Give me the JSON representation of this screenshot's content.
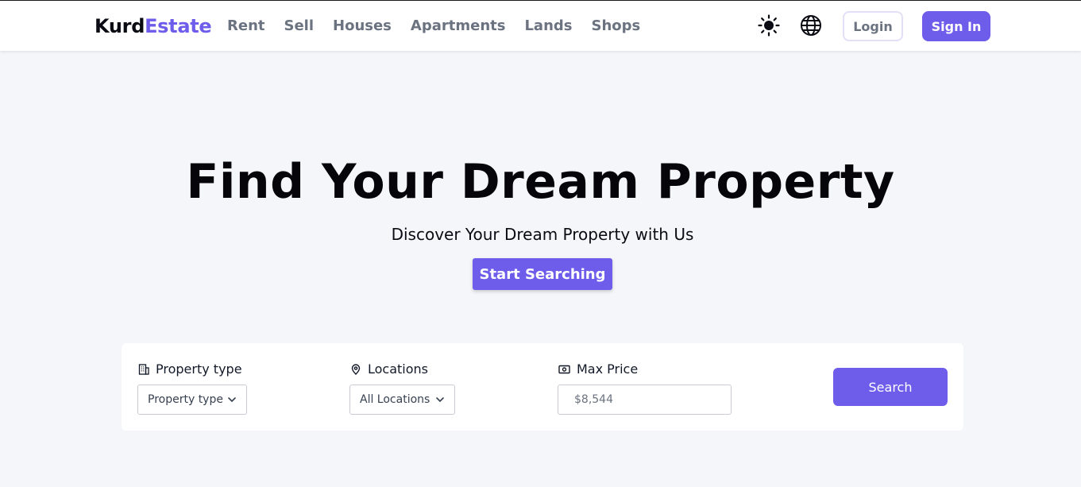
{
  "brand": {
    "part1": "Kurd",
    "part2": "Estate"
  },
  "nav": {
    "links": [
      "Rent",
      "Sell",
      "Houses",
      "Apartments",
      "Lands",
      "Shops"
    ],
    "theme_icon": "sun-icon",
    "language_icon": "globe-icon",
    "login_label": "Login",
    "signin_label": "Sign In"
  },
  "hero": {
    "title": "Find Your Dream Property",
    "subtitle": "Discover Your Dream Property with Us",
    "cta_label": "Start Searching"
  },
  "search": {
    "property_type": {
      "label": "Property type",
      "icon": "building-icon",
      "value": "Property type"
    },
    "locations": {
      "label": "Locations",
      "icon": "map-pin-icon",
      "value": "All Locations"
    },
    "max_price": {
      "label": "Max Price",
      "icon": "money-icon",
      "placeholder": "$8,544"
    },
    "button_label": "Search"
  },
  "colors": {
    "accent": "#6d5dea",
    "background": "#f5f6fa",
    "nav_text": "#6b7280"
  }
}
